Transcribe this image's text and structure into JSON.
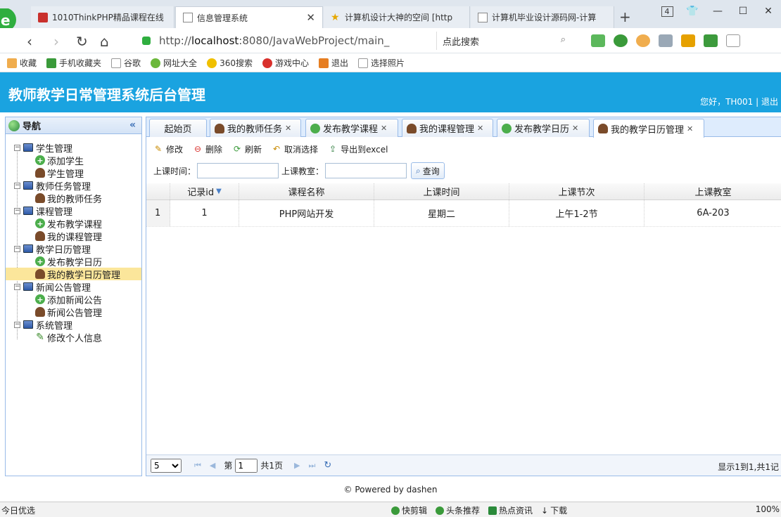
{
  "browser": {
    "tabs": [
      {
        "title": "1010ThinkPHP精品课程在线",
        "closable": false
      },
      {
        "title": "信息管理系统",
        "closable": true
      },
      {
        "title": "计算机设计大神的空间 [http",
        "closable": false
      },
      {
        "title": "计算机毕业设计源码网-计算",
        "closable": false
      }
    ],
    "tab_count": "4",
    "url_prefix": "http://",
    "url_host": "localhost",
    "url_rest": ":8080/JavaWebProject/main_",
    "search_placeholder": "点此搜索",
    "bookmarks": [
      "收藏",
      "手机收藏夹",
      "谷歌",
      "网址大全",
      "360搜索",
      "游戏中心",
      "退出",
      "选择照片"
    ]
  },
  "app": {
    "title": "教师教学日常管理系统后台管理",
    "user_greeting": "您好，TH001 | 退出"
  },
  "nav": {
    "title": "导航",
    "groups": [
      {
        "label": "学生管理",
        "items": [
          {
            "label": "添加学生",
            "icon": "add"
          },
          {
            "label": "学生管理",
            "icon": "user"
          }
        ]
      },
      {
        "label": "教师任务管理",
        "items": [
          {
            "label": "我的教师任务",
            "icon": "user"
          }
        ]
      },
      {
        "label": "课程管理",
        "items": [
          {
            "label": "发布教学课程",
            "icon": "add"
          },
          {
            "label": "我的课程管理",
            "icon": "user"
          }
        ]
      },
      {
        "label": "教学日历管理",
        "items": [
          {
            "label": "发布教学日历",
            "icon": "add"
          },
          {
            "label": "我的教学日历管理",
            "icon": "user",
            "selected": true
          }
        ]
      },
      {
        "label": "新闻公告管理",
        "items": [
          {
            "label": "添加新闻公告",
            "icon": "add"
          },
          {
            "label": "新闻公告管理",
            "icon": "user"
          }
        ]
      },
      {
        "label": "系统管理",
        "items": [
          {
            "label": "修改个人信息",
            "icon": "edit"
          }
        ]
      }
    ]
  },
  "main_tabs": [
    {
      "label": "起始页",
      "icon": "none",
      "closable": false
    },
    {
      "label": "我的教师任务",
      "icon": "user",
      "closable": true
    },
    {
      "label": "发布教学课程",
      "icon": "add",
      "closable": true
    },
    {
      "label": "我的课程管理",
      "icon": "user",
      "closable": true
    },
    {
      "label": "发布教学日历",
      "icon": "add",
      "closable": true
    },
    {
      "label": "我的教学日历管理",
      "icon": "user",
      "closable": true,
      "active": true
    }
  ],
  "toolbar": {
    "edit": "修改",
    "delete": "删除",
    "refresh": "刷新",
    "cancel_select": "取消选择",
    "export": "导出到excel"
  },
  "search": {
    "time_label": "上课时间：",
    "room_label": "上课教室：",
    "button": "查询"
  },
  "grid": {
    "columns": [
      "记录id",
      "课程名称",
      "上课时间",
      "上课节次",
      "上课教室"
    ],
    "rows": [
      {
        "num": "1",
        "cells": [
          "1",
          "PHP网站开发",
          "星期二",
          "上午1-2节",
          "6A-203"
        ]
      }
    ]
  },
  "pager": {
    "page_size": "5",
    "page_prefix": "第",
    "page_value": "1",
    "page_total": "共1页",
    "summary": "显示1到1,共1记"
  },
  "footer": "© Powered by dashen",
  "statusbar": {
    "left": "今日优选",
    "items": [
      "快剪辑",
      "头条推荐",
      "热点资讯",
      "下载"
    ],
    "zoom": "100%"
  }
}
